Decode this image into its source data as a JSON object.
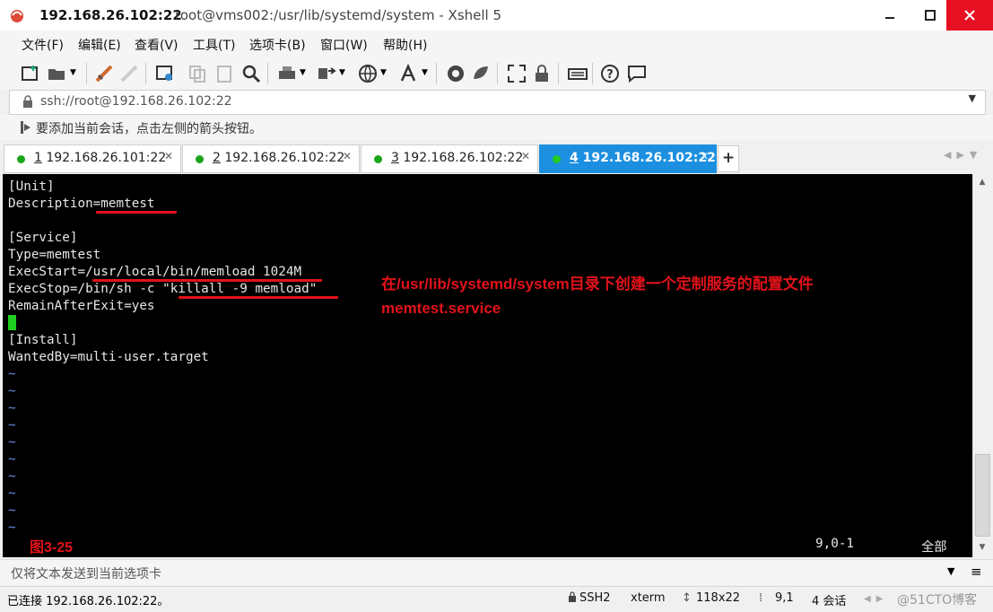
{
  "window": {
    "title_host": "192.168.26.102:22",
    "title_rest": "root@vms002:/usr/lib/systemd/system - Xshell 5"
  },
  "menu": [
    "文件(F)",
    "编辑(E)",
    "查看(V)",
    "工具(T)",
    "选项卡(B)",
    "窗口(W)",
    "帮助(H)"
  ],
  "address": {
    "value": "ssh://root@192.168.26.102:22"
  },
  "hint": "要添加当前会话，点击左侧的箭头按钮。",
  "tabs": [
    {
      "num": "1",
      "host": "192.168.26.101:22",
      "active": false
    },
    {
      "num": "2",
      "host": "192.168.26.102:22",
      "active": false
    },
    {
      "num": "3",
      "host": "192.168.26.102:22",
      "active": false
    },
    {
      "num": "4",
      "host": "192.168.26.102:22",
      "active": true
    }
  ],
  "terminal": {
    "lines": [
      "[Unit]",
      "Description=memtest",
      "",
      "[Service]",
      "Type=memtest",
      "ExecStart=/usr/local/bin/memload 1024M",
      "ExecStop=/bin/sh -c \"killall -9 memload\"",
      "RemainAfterExit=yes",
      "",
      "[Install]",
      "WantedBy=multi-user.target"
    ],
    "tilde": "~",
    "tilde_count": 10,
    "position": "9,0-1",
    "scroll": "全部"
  },
  "annotation": {
    "line1": "在/usr/lib/systemd/system目录下创建一个定制服务的配置文件",
    "line2": "memtest.service",
    "figure": "图3-25"
  },
  "sendbar": {
    "placeholder": "仅将文本发送到当前选项卡"
  },
  "status": {
    "connection": "已连接 192.168.26.102:22。",
    "protocol": "SSH2",
    "terminal_type": "xterm",
    "size": "118x22",
    "cursor": "9,1",
    "sessions": "4 会话",
    "watermark": "@51CTO博客"
  },
  "colors": {
    "active_tab": "#1c8fe0",
    "annotation": "#e2121a",
    "cursor": "#1fd01f",
    "close_button": "#e81123"
  }
}
